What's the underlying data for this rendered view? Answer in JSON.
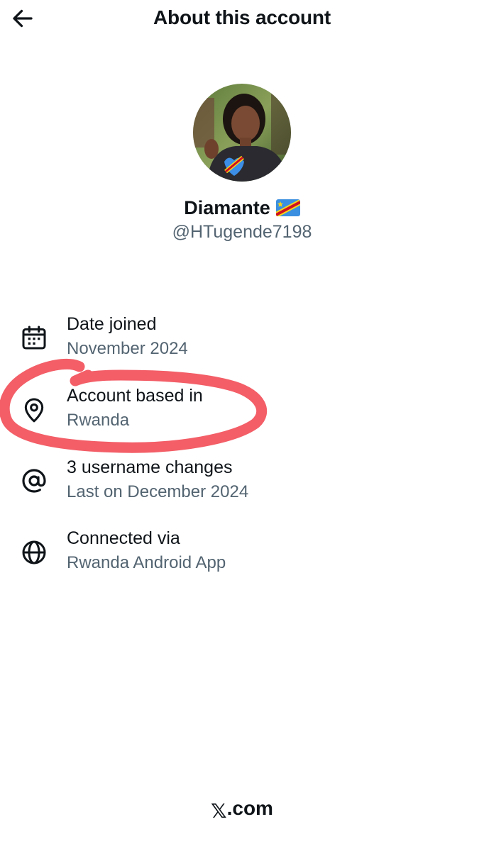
{
  "header": {
    "title": "About this account",
    "back_icon": "arrow-left-icon"
  },
  "profile": {
    "name": "Diamante",
    "flag_icon": "dr-congo-flag-icon",
    "handle": "@HTugende7198"
  },
  "info": [
    {
      "icon": "calendar-icon",
      "label": "Date joined",
      "value": "November 2024"
    },
    {
      "icon": "location-pin-icon",
      "label": "Account based in",
      "value": "Rwanda"
    },
    {
      "icon": "at-sign-icon",
      "label": "3 username changes",
      "value": "Last on December 2024"
    },
    {
      "icon": "globe-icon",
      "label": "Connected via",
      "value": "Rwanda Android App"
    }
  ],
  "annotation": {
    "color": "#f2505a"
  },
  "footer": {
    "x_glyph": "𝕏",
    "suffix": ".com"
  },
  "colors": {
    "primary_text": "#0f1419",
    "secondary_text": "#536471"
  }
}
